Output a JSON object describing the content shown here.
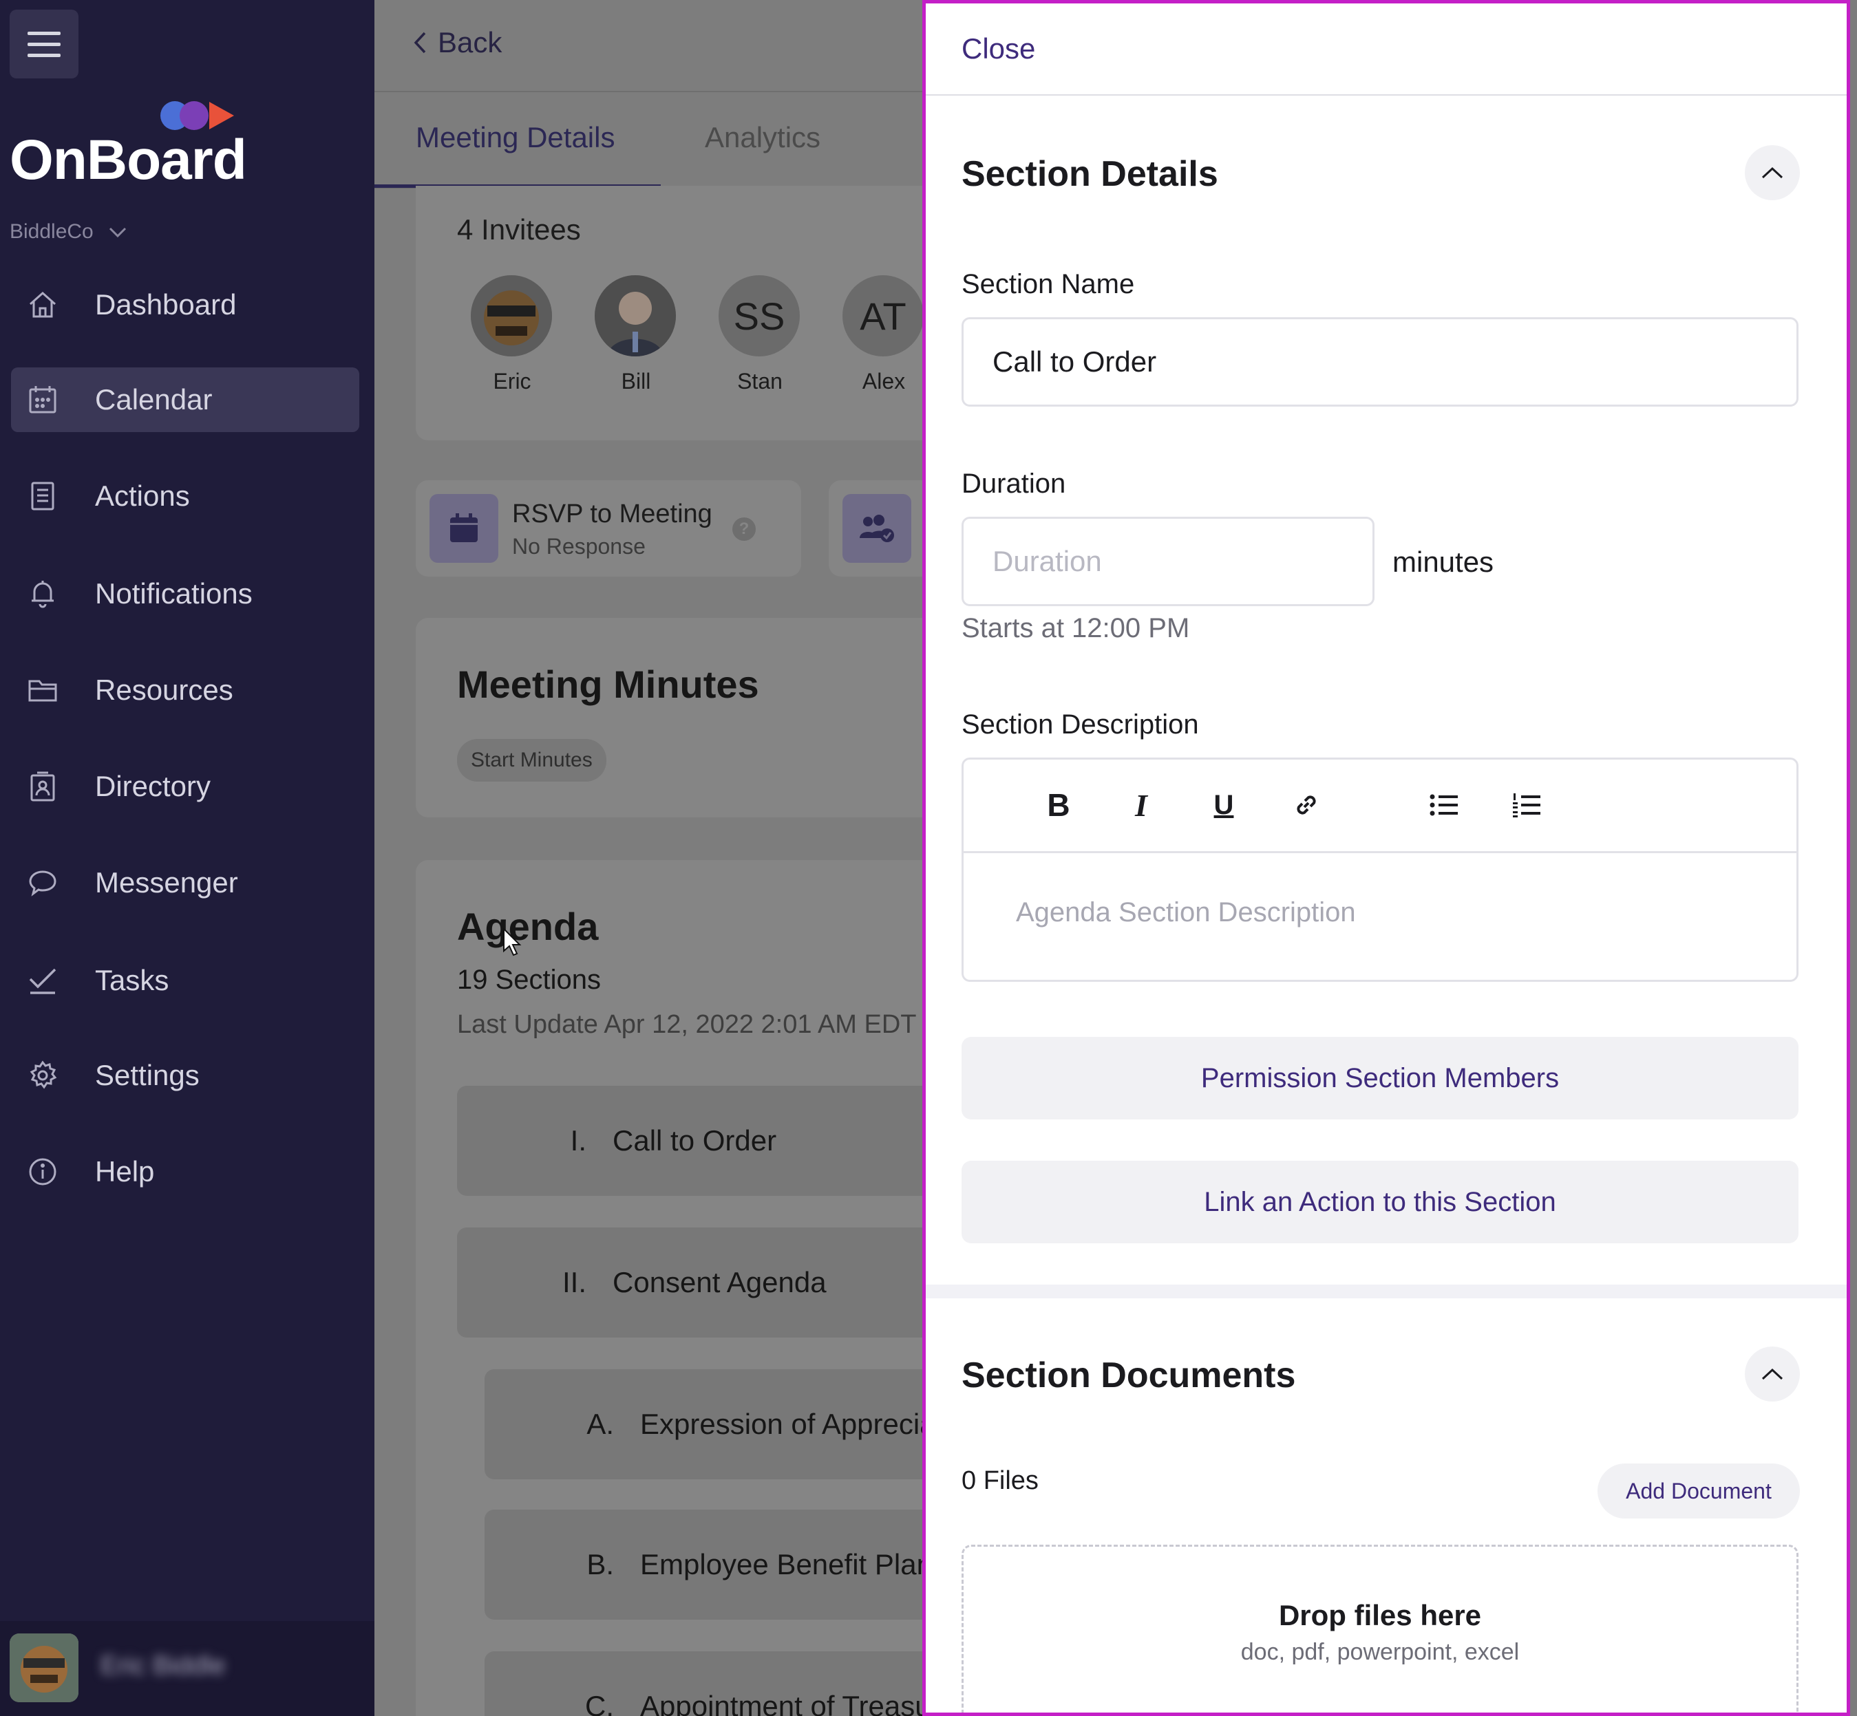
{
  "sidebar": {
    "logo": "OnBoard",
    "org": "BiddleCo",
    "items": [
      {
        "label": "Dashboard",
        "icon": "home-icon"
      },
      {
        "label": "Calendar",
        "icon": "calendar-icon",
        "active": true
      },
      {
        "label": "Actions",
        "icon": "clipboard-icon"
      },
      {
        "label": "Notifications",
        "icon": "bell-icon"
      },
      {
        "label": "Resources",
        "icon": "folder-icon"
      },
      {
        "label": "Directory",
        "icon": "contact-book-icon"
      },
      {
        "label": "Messenger",
        "icon": "chat-icon"
      },
      {
        "label": "Tasks",
        "icon": "check-icon"
      },
      {
        "label": "Settings",
        "icon": "gear-icon"
      },
      {
        "label": "Help",
        "icon": "info-icon"
      }
    ],
    "user_name": "Eric Biddle"
  },
  "main": {
    "back_label": "Back",
    "tabs": [
      {
        "label": "Meeting Details",
        "active": true
      },
      {
        "label": "Analytics"
      }
    ],
    "invitees": {
      "count_label": "4 Invitees",
      "people": [
        {
          "name": "Eric",
          "initials": ""
        },
        {
          "name": "Bill",
          "initials": ""
        },
        {
          "name": "Stan",
          "initials": "SS"
        },
        {
          "name": "Alex",
          "initials": "AT"
        }
      ]
    },
    "rsvp": {
      "title": "RSVP to Meeting",
      "status": "No Response",
      "help": "?"
    },
    "minutes": {
      "title": "Meeting Minutes",
      "button": "Start Minutes"
    },
    "agenda": {
      "title": "Agenda",
      "count": "19 Sections",
      "updated": "Last Update Apr 12, 2022 2:01 AM EDT",
      "items": [
        {
          "num": "I.",
          "label": "Call to Order"
        },
        {
          "num": "II.",
          "label": "Consent Agenda"
        },
        {
          "num": "A.",
          "label": "Expression of Appreciation"
        },
        {
          "num": "B.",
          "label": "Employee Benefit Plan"
        },
        {
          "num": "C.",
          "label": "Appointment of Treasurer"
        }
      ]
    }
  },
  "panel": {
    "close_label": "Close",
    "section_details": {
      "title": "Section Details",
      "name_label": "Section Name",
      "name_value": "Call to Order",
      "duration_label": "Duration",
      "duration_placeholder": "Duration",
      "duration_unit": "minutes",
      "starts_at": "Starts at 12:00 PM",
      "description_label": "Section Description",
      "description_placeholder": "Agenda Section Description",
      "toolbar": {
        "bold": "B",
        "italic": "I",
        "underline": "U"
      },
      "permission_button": "Permission Section Members",
      "link_action_button": "Link an Action to this Section"
    },
    "section_documents": {
      "title": "Section Documents",
      "files_count": "0 Files",
      "add_button": "Add Document",
      "drop_title": "Drop files here",
      "drop_types": "doc, pdf, powerpoint, excel"
    }
  },
  "colors": {
    "accent": "#3e2b7c",
    "sidebar_bg": "#1f1c3a",
    "panel_border": "#c41fc7"
  }
}
